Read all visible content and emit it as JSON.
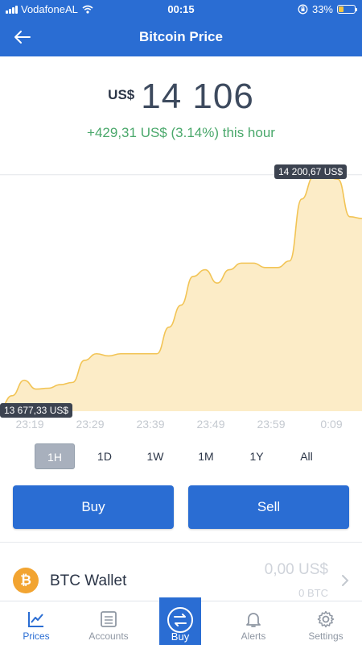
{
  "status_bar": {
    "carrier": "VodafoneAL",
    "time": "00:15",
    "battery": "33%"
  },
  "nav": {
    "title": "Bitcoin Price"
  },
  "price": {
    "currency": "US$",
    "value": "14 106",
    "change": "+429,31 US$ (3.14%) this hour"
  },
  "colors": {
    "brand": "#2a6dd3",
    "positive": "#4aa86b",
    "chart_line": "#f2c455",
    "chart_fill": "#fcecc7",
    "bitcoin": "#f2a431"
  },
  "chart": {
    "high_label": "14 200,67 US$",
    "low_label": "13 677,33 US$",
    "time_ticks": [
      "23:19",
      "23:29",
      "23:39",
      "23:49",
      "23:59",
      "0:09"
    ]
  },
  "chart_data": {
    "type": "area",
    "title": "",
    "xlabel": "",
    "ylabel": "",
    "x": [
      "23:15",
      "23:17",
      "23:19",
      "23:21",
      "23:23",
      "23:25",
      "23:27",
      "23:29",
      "23:31",
      "23:33",
      "23:35",
      "23:37",
      "23:39",
      "23:41",
      "23:43",
      "23:45",
      "23:47",
      "23:49",
      "23:51",
      "23:53",
      "23:55",
      "23:57",
      "23:59",
      "0:01",
      "0:03",
      "0:05",
      "0:07",
      "0:09",
      "0:11",
      "0:13",
      "0:15"
    ],
    "series": [
      {
        "values": [
          13677.33,
          13705,
          13740,
          13720,
          13722,
          13730,
          13735,
          13785,
          13800,
          13795,
          13800,
          13800,
          13800,
          13800,
          13860,
          13910,
          13975,
          13990,
          13960,
          13990,
          14005,
          14005,
          13995,
          13995,
          14010,
          14150,
          14200.67,
          14200.67,
          14195,
          14110,
          14106
        ]
      }
    ],
    "ylim": [
      13670,
      14210
    ],
    "grid": false,
    "legend": "none"
  },
  "ranges": {
    "items": [
      "1H",
      "1D",
      "1W",
      "1M",
      "1Y",
      "All"
    ],
    "active": "1H"
  },
  "actions": {
    "buy": "Buy",
    "sell": "Sell"
  },
  "wallet": {
    "coin_symbol": "₿",
    "name": "BTC Wallet",
    "fiat_balance": "0,00 US$",
    "crypto_balance": "0 BTC"
  },
  "tabs": {
    "prices": "Prices",
    "accounts": "Accounts",
    "buy": "Buy",
    "alerts": "Alerts",
    "settings": "Settings"
  }
}
